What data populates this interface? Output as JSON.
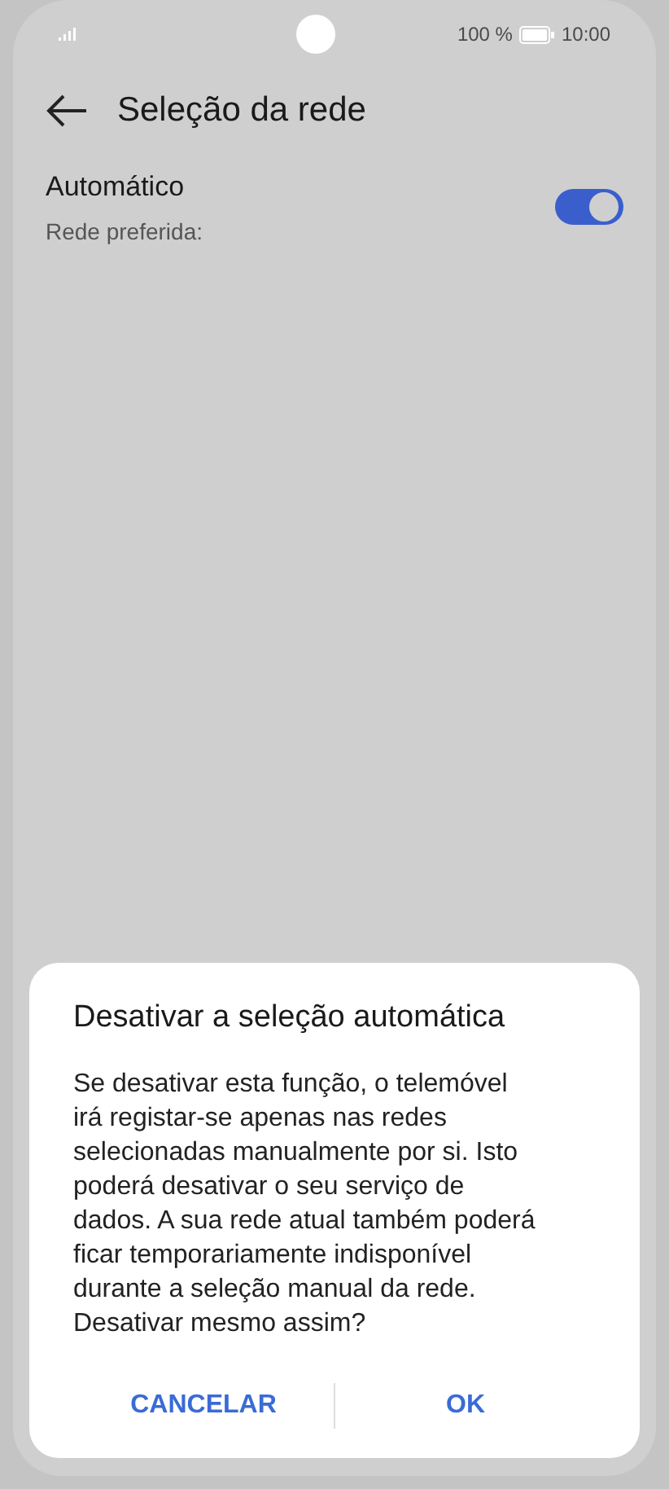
{
  "status_bar": {
    "battery": "100 %",
    "time": "10:00"
  },
  "header": {
    "title": "Seleção da rede"
  },
  "setting": {
    "label": "Automático",
    "sublabel": "Rede preferida:",
    "on": true
  },
  "dialog": {
    "title": "Desativar a seleção automática",
    "message": "Se desativar esta função, o telemóvel irá registar-se apenas nas redes selecionadas manualmente por si. Isto poderá desativar o seu serviço de dados. A sua rede atual também poderá ficar temporariamente indisponível durante a seleção manual da rede. Desativar mesmo assim?",
    "buttons": [
      "CANCELAR",
      "OK"
    ]
  }
}
